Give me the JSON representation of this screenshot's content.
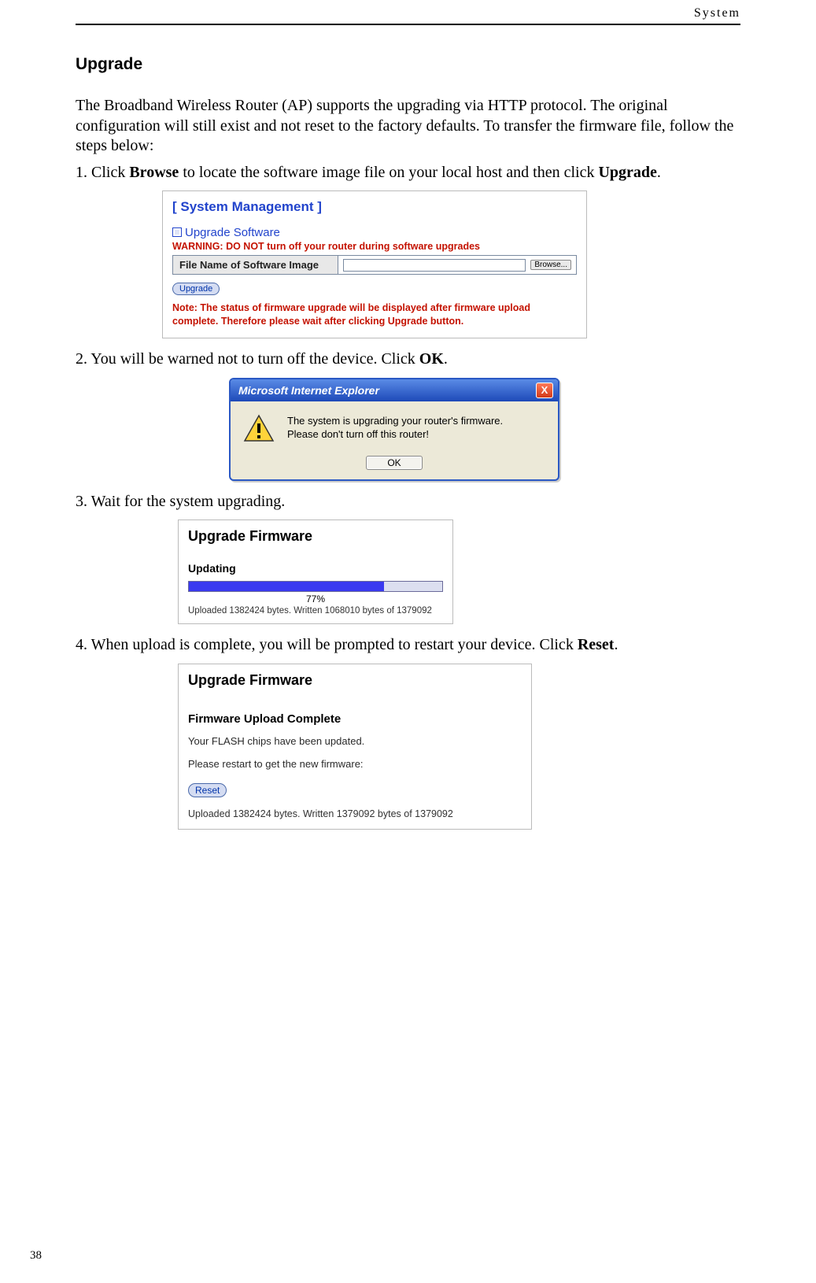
{
  "header": {
    "section": "System"
  },
  "page": {
    "number": "38"
  },
  "title": "Upgrade",
  "intro": "The Broadband Wireless Router (AP) supports the upgrading via HTTP protocol. The original configuration will still exist and not reset to the factory defaults. To transfer the firmware file, follow the steps below:",
  "step1": {
    "pre": "1.  Click ",
    "b1": "Browse",
    "mid": " to locate the software image file on your local host and then click ",
    "b2": "Upgrade",
    "post": "."
  },
  "panel1": {
    "title": "[ System Management ]",
    "heading": "Upgrade Software",
    "warning_label": "WARNING: ",
    "warning_text": "DO NOT turn off your router during software upgrades",
    "file_label": "File Name of Software Image",
    "browse": "Browse...",
    "upgrade_btn": "Upgrade",
    "note_label": "Note: ",
    "note_text": "The status of firmware upgrade will be displayed after firmware upload complete. Therefore please wait after clicking Upgrade button."
  },
  "step2": {
    "pre": "2. You will be warned not to turn off the device. Click ",
    "b1": "OK",
    "post": "."
  },
  "dialog": {
    "title": "Microsoft Internet Explorer",
    "close": "X",
    "msg1": "The system is upgrading your router's firmware.",
    "msg2": "Please don't turn off this router!",
    "ok": "OK"
  },
  "step3": "3. Wait for the system upgrading.",
  "panel3": {
    "title": "Upgrade Firmware",
    "sub": "Updating",
    "percent_text": "77%",
    "percent_value": 77,
    "status": "Uploaded 1382424 bytes. Written 1068010 bytes of 1379092"
  },
  "step4": {
    "pre": "4. When upload is complete, you will be prompted to restart your device. Click ",
    "b1": "Reset",
    "post": "."
  },
  "panel4": {
    "title": "Upgrade Firmware",
    "sub": "Firmware Upload Complete",
    "line1": "Your FLASH chips have been updated.",
    "line2": "Please restart to get the new firmware:",
    "reset_btn": "Reset",
    "status": "Uploaded 1382424 bytes. Written 1379092 bytes of 1379092"
  }
}
